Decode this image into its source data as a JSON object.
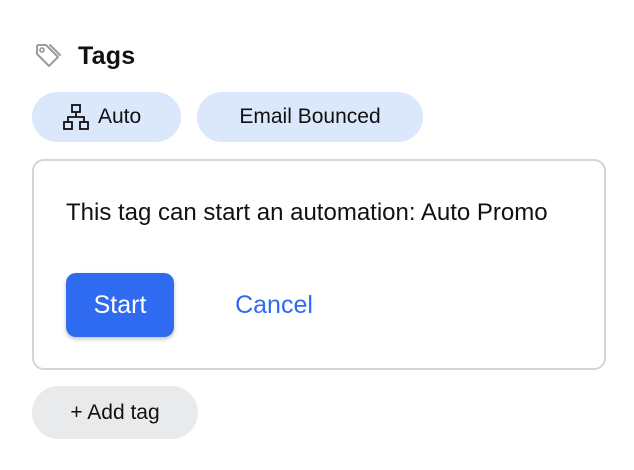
{
  "header": {
    "title": "Tags",
    "icon": "tag-icon"
  },
  "tags": [
    {
      "label": "Auto",
      "icon": "network-icon"
    },
    {
      "label": "Email Bounced"
    }
  ],
  "prompt": {
    "message": "This tag can start an automation: Auto Promo",
    "start_label": "Start",
    "cancel_label": "Cancel"
  },
  "add_tag_label": "+ Add tag",
  "colors": {
    "accent": "#2f6bf0",
    "chip_bg": "#dbe7fb",
    "add_tag_bg": "#e9eaec",
    "card_border": "#d2d5da"
  }
}
